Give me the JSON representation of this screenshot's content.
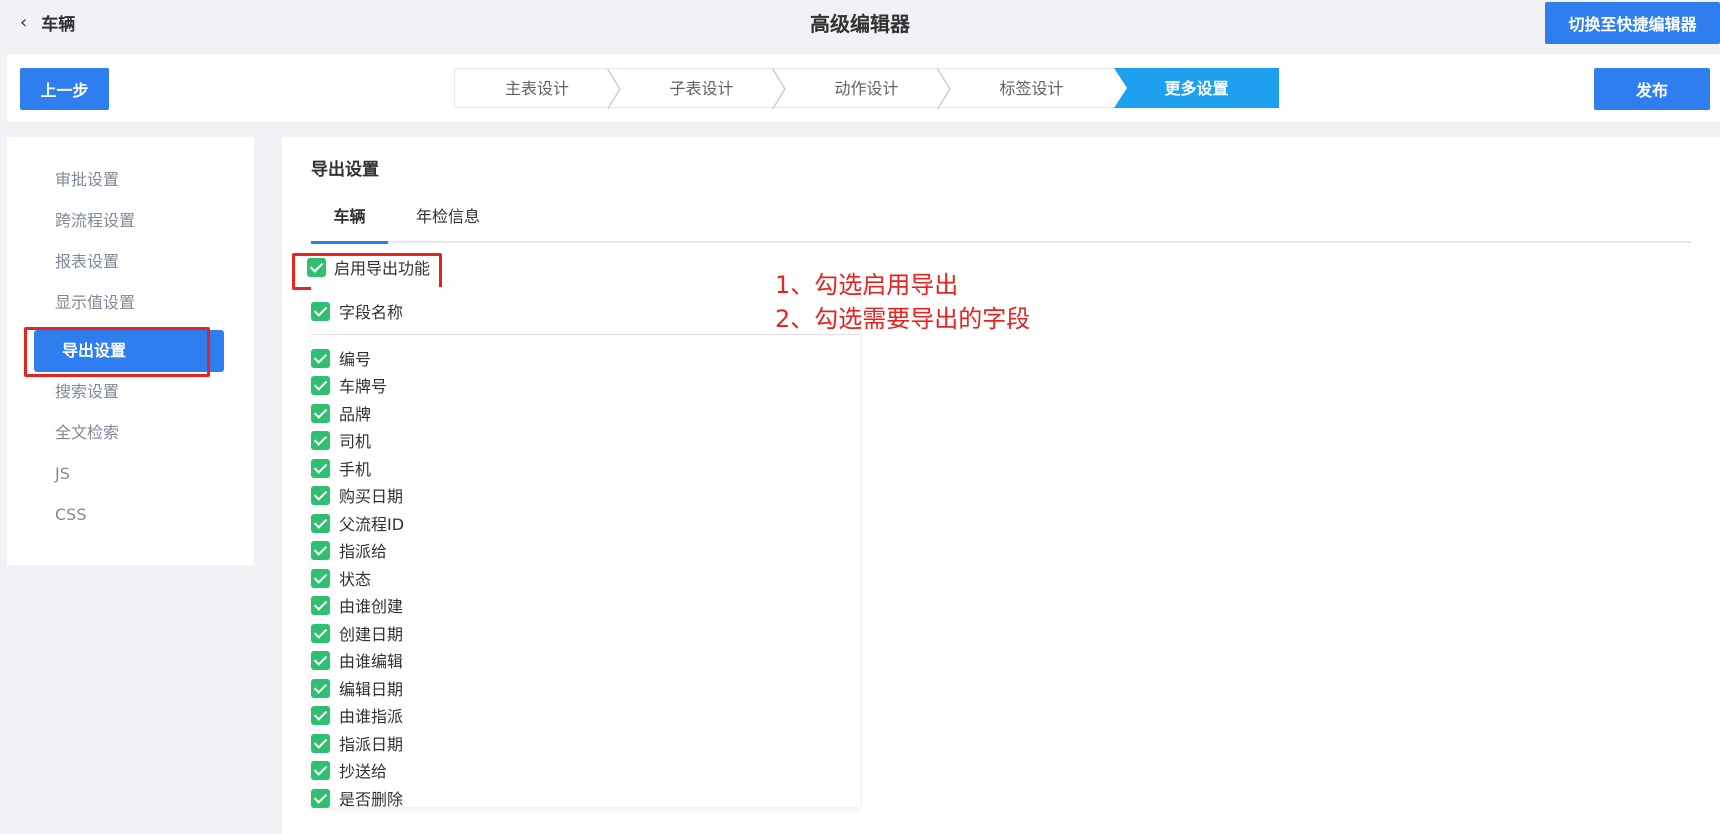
{
  "header": {
    "back_label": "车辆",
    "title": "高级编辑器",
    "switch_button": "切换至快捷编辑器"
  },
  "stepsbar": {
    "prev_button": "上一步",
    "publish_button": "发布",
    "steps": [
      {
        "label": "主表设计",
        "active": false
      },
      {
        "label": "子表设计",
        "active": false
      },
      {
        "label": "动作设计",
        "active": false
      },
      {
        "label": "标签设计",
        "active": false
      },
      {
        "label": "更多设置",
        "active": true
      }
    ]
  },
  "sidebar": {
    "items": [
      {
        "label": "审批设置"
      },
      {
        "label": "跨流程设置"
      },
      {
        "label": "报表设置"
      },
      {
        "label": "显示值设置"
      },
      {
        "label": "导出设置",
        "active": true
      },
      {
        "label": "搜索设置"
      },
      {
        "label": "全文检索"
      },
      {
        "label": "JS"
      },
      {
        "label": "CSS"
      }
    ]
  },
  "main": {
    "section_title": "导出设置",
    "tabs": [
      {
        "label": "车辆",
        "active": true
      },
      {
        "label": "年检信息",
        "active": false
      }
    ],
    "enable_export": {
      "label": "启用导出功能",
      "checked": true
    },
    "field_header": {
      "label": "字段名称",
      "checked": true
    },
    "fields": [
      {
        "label": "编号",
        "checked": true
      },
      {
        "label": "车牌号",
        "checked": true
      },
      {
        "label": "品牌",
        "checked": true
      },
      {
        "label": "司机",
        "checked": true
      },
      {
        "label": "手机",
        "checked": true
      },
      {
        "label": "购买日期",
        "checked": true
      },
      {
        "label": "父流程ID",
        "checked": true
      },
      {
        "label": "指派给",
        "checked": true
      },
      {
        "label": "状态",
        "checked": true
      },
      {
        "label": "由谁创建",
        "checked": true
      },
      {
        "label": "创建日期",
        "checked": true
      },
      {
        "label": "由谁编辑",
        "checked": true
      },
      {
        "label": "编辑日期",
        "checked": true
      },
      {
        "label": "由谁指派",
        "checked": true
      },
      {
        "label": "指派日期",
        "checked": true
      },
      {
        "label": "抄送给",
        "checked": true
      },
      {
        "label": "是否删除",
        "checked": true
      }
    ]
  },
  "annotations": {
    "step1": "1、勾选启用导出",
    "step2": "2、勾选需要导出的字段",
    "color": "#e8231f"
  },
  "colors": {
    "primary": "#2f7ef0",
    "step_active": "#1ea0f0",
    "checkbox": "#2fbf71"
  }
}
